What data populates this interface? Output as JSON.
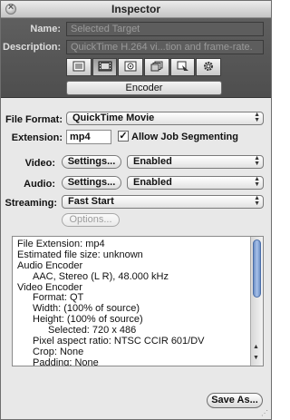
{
  "window": {
    "title": "Inspector"
  },
  "header": {
    "name_label": "Name:",
    "name_value": "Selected Target",
    "description_label": "Description:",
    "description_value": "QuickTime H.264 vi...tion and frame-rate.",
    "tabs": [
      {
        "icon": "summary-icon",
        "selected": false
      },
      {
        "icon": "encoder-film-icon",
        "selected": true
      },
      {
        "icon": "frame-controls-icon",
        "selected": false
      },
      {
        "icon": "filters-icon",
        "selected": false
      },
      {
        "icon": "geometry-icon",
        "selected": false
      },
      {
        "icon": "actions-gear-icon",
        "selected": false
      }
    ],
    "active_tab_label": "Encoder"
  },
  "encoder": {
    "file_format_label": "File Format:",
    "file_format_value": "QuickTime Movie",
    "extension_label": "Extension:",
    "extension_value": "mp4",
    "allow_segmenting_label": "Allow Job Segmenting",
    "allow_segmenting_checked": true,
    "checkmark": "✓",
    "video_label": "Video:",
    "video_settings_label": "Settings...",
    "video_state": "Enabled",
    "audio_label": "Audio:",
    "audio_settings_label": "Settings...",
    "audio_state": "Enabled",
    "streaming_label": "Streaming:",
    "streaming_value": "Fast Start",
    "options_label": "Options..."
  },
  "summary": {
    "lines": [
      {
        "text": "File Extension: mp4",
        "indent": 0
      },
      {
        "text": "Estimated file size: unknown",
        "indent": 0
      },
      {
        "text": "Audio Encoder",
        "indent": 0
      },
      {
        "text": "AAC, Stereo (L R), 48.000 kHz",
        "indent": 1
      },
      {
        "text": "Video Encoder",
        "indent": 0
      },
      {
        "text": "Format: QT",
        "indent": 1
      },
      {
        "text": "Width: (100% of source)",
        "indent": 1
      },
      {
        "text": "Height: (100% of source)",
        "indent": 1
      },
      {
        "text": "Selected: 720 x 486",
        "indent": 2
      },
      {
        "text": "Pixel aspect ratio: NTSC CCIR 601/DV",
        "indent": 1
      },
      {
        "text": "Crop: None",
        "indent": 1
      },
      {
        "text": "Padding: None",
        "indent": 1
      }
    ]
  },
  "footer": {
    "save_as_label": "Save As..."
  },
  "colors": {
    "header_bg": "#555555",
    "scroll_thumb": "#8aa9d9",
    "window_bg": "#e8e8e8"
  }
}
